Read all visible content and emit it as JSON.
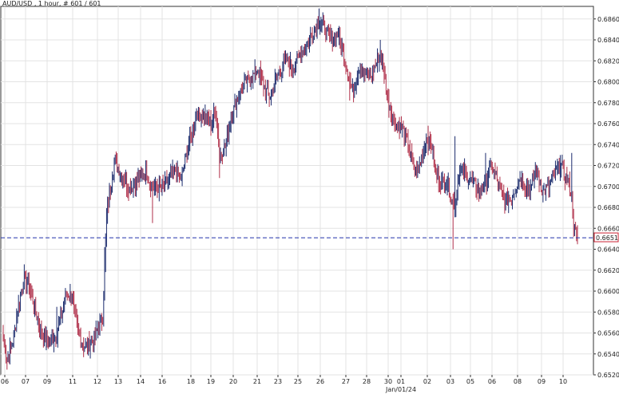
{
  "header": {
    "title": "AUD/USD , 1 hour, # 601 / 601"
  },
  "chart_data": {
    "type": "candlestick",
    "title": "AUD/USD , 1 hour, # 601 / 601",
    "ylim": [
      0.652,
      0.6872
    ],
    "y_ticks": [
      "0.6520",
      "0.6540",
      "0.6560",
      "0.6580",
      "0.6600",
      "0.6620",
      "0.6640",
      "0.6660",
      "0.6680",
      "0.6700",
      "0.6720",
      "0.6740",
      "0.6760",
      "0.6780",
      "0.6800",
      "0.6820",
      "0.6840",
      "0.6860"
    ],
    "x_ticks": [
      "06",
      "07",
      "09",
      "11",
      "12",
      "13",
      "14",
      "16",
      "18",
      "19",
      "20",
      "21",
      "23",
      "25",
      "26",
      "27",
      "28",
      "30",
      "01",
      "02",
      "03",
      "05",
      "06",
      "08",
      "09",
      "10"
    ],
    "x_sublabel": "Jan/01/24",
    "last_price": 0.6651,
    "last_price_label": "0.6651",
    "grid": true,
    "bars_total": 601,
    "path": [
      [
        0,
        0.6558
      ],
      [
        4,
        0.6534
      ],
      [
        10,
        0.6552
      ],
      [
        14,
        0.6575
      ],
      [
        18,
        0.6598
      ],
      [
        22,
        0.6612
      ],
      [
        26,
        0.6606
      ],
      [
        32,
        0.6587
      ],
      [
        38,
        0.6566
      ],
      [
        44,
        0.6555
      ],
      [
        50,
        0.6552
      ],
      [
        56,
        0.656
      ],
      [
        62,
        0.6582
      ],
      [
        66,
        0.6598
      ],
      [
        72,
        0.6594
      ],
      [
        76,
        0.657
      ],
      [
        82,
        0.655
      ],
      [
        88,
        0.6547
      ],
      [
        94,
        0.6553
      ],
      [
        100,
        0.6566
      ],
      [
        104,
        0.6575
      ],
      [
        106,
        0.662
      ],
      [
        108,
        0.667
      ],
      [
        112,
        0.67
      ],
      [
        116,
        0.6722
      ],
      [
        124,
        0.6712
      ],
      [
        132,
        0.6698
      ],
      [
        140,
        0.6705
      ],
      [
        148,
        0.6715
      ],
      [
        156,
        0.67
      ],
      [
        164,
        0.6698
      ],
      [
        172,
        0.6706
      ],
      [
        180,
        0.6716
      ],
      [
        186,
        0.6706
      ],
      [
        190,
        0.6725
      ],
      [
        196,
        0.6748
      ],
      [
        202,
        0.677
      ],
      [
        210,
        0.6768
      ],
      [
        218,
        0.676
      ],
      [
        222,
        0.6775
      ],
      [
        226,
        0.673
      ],
      [
        232,
        0.6738
      ],
      [
        236,
        0.6758
      ],
      [
        242,
        0.6777
      ],
      [
        248,
        0.679
      ],
      [
        254,
        0.68
      ],
      [
        260,
        0.6804
      ],
      [
        266,
        0.6812
      ],
      [
        272,
        0.6796
      ],
      [
        278,
        0.6785
      ],
      [
        284,
        0.68
      ],
      [
        290,
        0.6812
      ],
      [
        296,
        0.682
      ],
      [
        302,
        0.6815
      ],
      [
        308,
        0.6822
      ],
      [
        314,
        0.6832
      ],
      [
        320,
        0.684
      ],
      [
        326,
        0.685
      ],
      [
        330,
        0.6858
      ],
      [
        334,
        0.6855
      ],
      [
        338,
        0.6847
      ],
      [
        344,
        0.684
      ],
      [
        350,
        0.6846
      ],
      [
        356,
        0.6826
      ],
      [
        362,
        0.68
      ],
      [
        366,
        0.679
      ],
      [
        372,
        0.6815
      ],
      [
        378,
        0.6808
      ],
      [
        384,
        0.6806
      ],
      [
        390,
        0.6818
      ],
      [
        394,
        0.6828
      ],
      [
        398,
        0.681
      ],
      [
        402,
        0.6782
      ],
      [
        408,
        0.6762
      ],
      [
        414,
        0.6758
      ],
      [
        418,
        0.6752
      ],
      [
        424,
        0.6738
      ],
      [
        428,
        0.6718
      ],
      [
        432,
        0.6714
      ],
      [
        438,
        0.673
      ],
      [
        442,
        0.6746
      ],
      [
        448,
        0.6738
      ],
      [
        452,
        0.6712
      ],
      [
        458,
        0.6702
      ],
      [
        464,
        0.6704
      ],
      [
        468,
        0.6688
      ],
      [
        472,
        0.6682
      ],
      [
        476,
        0.671
      ],
      [
        480,
        0.6716
      ],
      [
        486,
        0.6708
      ],
      [
        492,
        0.6702
      ],
      [
        498,
        0.6695
      ],
      [
        504,
        0.6704
      ],
      [
        510,
        0.672
      ],
      [
        514,
        0.6712
      ],
      [
        518,
        0.67
      ],
      [
        524,
        0.6686
      ],
      [
        530,
        0.6688
      ],
      [
        536,
        0.67
      ],
      [
        540,
        0.6708
      ],
      [
        546,
        0.67
      ],
      [
        552,
        0.6698
      ],
      [
        556,
        0.6715
      ],
      [
        560,
        0.6706
      ],
      [
        564,
        0.6695
      ],
      [
        570,
        0.67
      ],
      [
        576,
        0.671
      ],
      [
        582,
        0.6722
      ],
      [
        586,
        0.6712
      ],
      [
        590,
        0.6706
      ],
      [
        594,
        0.669
      ],
      [
        596,
        0.6664
      ],
      [
        598,
        0.6655
      ],
      [
        600,
        0.6651
      ]
    ],
    "spikes": [
      [
        4,
        0.6534,
        0.6525
      ],
      [
        56,
        0.656,
        0.6585
      ],
      [
        106,
        0.662,
        0.6642
      ],
      [
        150,
        0.6715,
        0.6725
      ],
      [
        156,
        0.67,
        0.6665
      ],
      [
        220,
        0.6775,
        0.678
      ],
      [
        226,
        0.673,
        0.6708
      ],
      [
        300,
        0.6815,
        0.6824
      ],
      [
        330,
        0.6858,
        0.687
      ],
      [
        362,
        0.68,
        0.6782
      ],
      [
        394,
        0.6828,
        0.684
      ],
      [
        444,
        0.6746,
        0.6758
      ],
      [
        470,
        0.6688,
        0.664
      ],
      [
        472,
        0.6682,
        0.6748
      ],
      [
        504,
        0.6704,
        0.6732
      ],
      [
        582,
        0.6722,
        0.673
      ],
      [
        594,
        0.669,
        0.6732
      ]
    ]
  }
}
